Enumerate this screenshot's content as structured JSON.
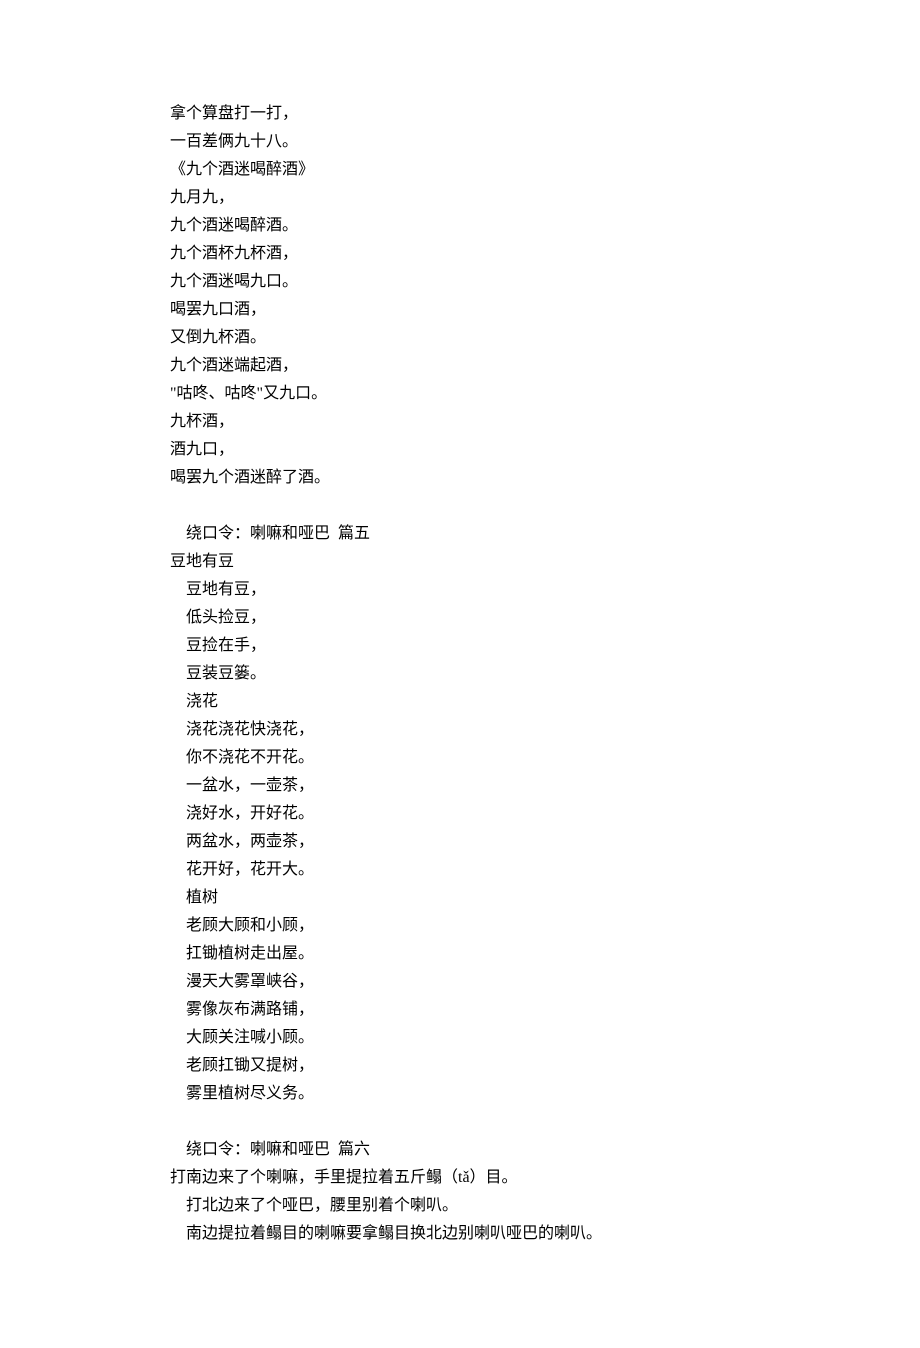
{
  "lines": [
    {
      "text": "拿个算盘打一打，",
      "indent": false
    },
    {
      "text": "一百差俩九十八。",
      "indent": false
    },
    {
      "text": "《九个酒迷喝醉酒》",
      "indent": false
    },
    {
      "text": "九月九，",
      "indent": false
    },
    {
      "text": "九个酒迷喝醉酒。",
      "indent": false
    },
    {
      "text": "九个酒杯九杯酒，",
      "indent": false
    },
    {
      "text": "九个酒迷喝九口。",
      "indent": false
    },
    {
      "text": "喝罢九口酒，",
      "indent": false
    },
    {
      "text": "又倒九杯酒。",
      "indent": false
    },
    {
      "text": "九个酒迷端起酒，",
      "indent": false
    },
    {
      "text": "\"咕咚、咕咚\"又九口。",
      "indent": false
    },
    {
      "text": "九杯酒，",
      "indent": false
    },
    {
      "text": "酒九口，",
      "indent": false
    },
    {
      "text": "喝罢九个酒迷醉了酒。",
      "indent": false
    },
    {
      "gap": true
    },
    {
      "text": "绕口令：喇嘛和哑巴  篇五",
      "indent": true
    },
    {
      "text": "豆地有豆",
      "indent": false
    },
    {
      "text": "豆地有豆，",
      "indent": true
    },
    {
      "text": "低头捡豆，",
      "indent": true
    },
    {
      "text": "豆捡在手，",
      "indent": true
    },
    {
      "text": "豆装豆篓。",
      "indent": true
    },
    {
      "text": "浇花",
      "indent": true
    },
    {
      "text": "浇花浇花快浇花，",
      "indent": true
    },
    {
      "text": "你不浇花不开花。",
      "indent": true
    },
    {
      "text": "一盆水，一壶茶，",
      "indent": true
    },
    {
      "text": "浇好水，开好花。",
      "indent": true
    },
    {
      "text": "两盆水，两壶茶，",
      "indent": true
    },
    {
      "text": "花开好，花开大。",
      "indent": true
    },
    {
      "text": "植树",
      "indent": true
    },
    {
      "text": "老顾大顾和小顾，",
      "indent": true
    },
    {
      "text": "扛锄植树走出屋。",
      "indent": true
    },
    {
      "text": "漫天大雾罩峡谷，",
      "indent": true
    },
    {
      "text": "雾像灰布满路铺，",
      "indent": true
    },
    {
      "text": "大顾关注喊小顾。",
      "indent": true
    },
    {
      "text": "老顾扛锄又提树，",
      "indent": true
    },
    {
      "text": "雾里植树尽义务。",
      "indent": true
    },
    {
      "gap": true
    },
    {
      "text": "绕口令：喇嘛和哑巴  篇六",
      "indent": true
    },
    {
      "text": "打南边来了个喇嘛，手里提拉着五斤鳎（tǎ）目。",
      "indent": false
    },
    {
      "text": "打北边来了个哑巴，腰里别着个喇叭。",
      "indent": true
    },
    {
      "text": "南边提拉着鳎目的喇嘛要拿鳎目换北边别喇叭哑巴的喇叭。",
      "indent": true
    }
  ]
}
